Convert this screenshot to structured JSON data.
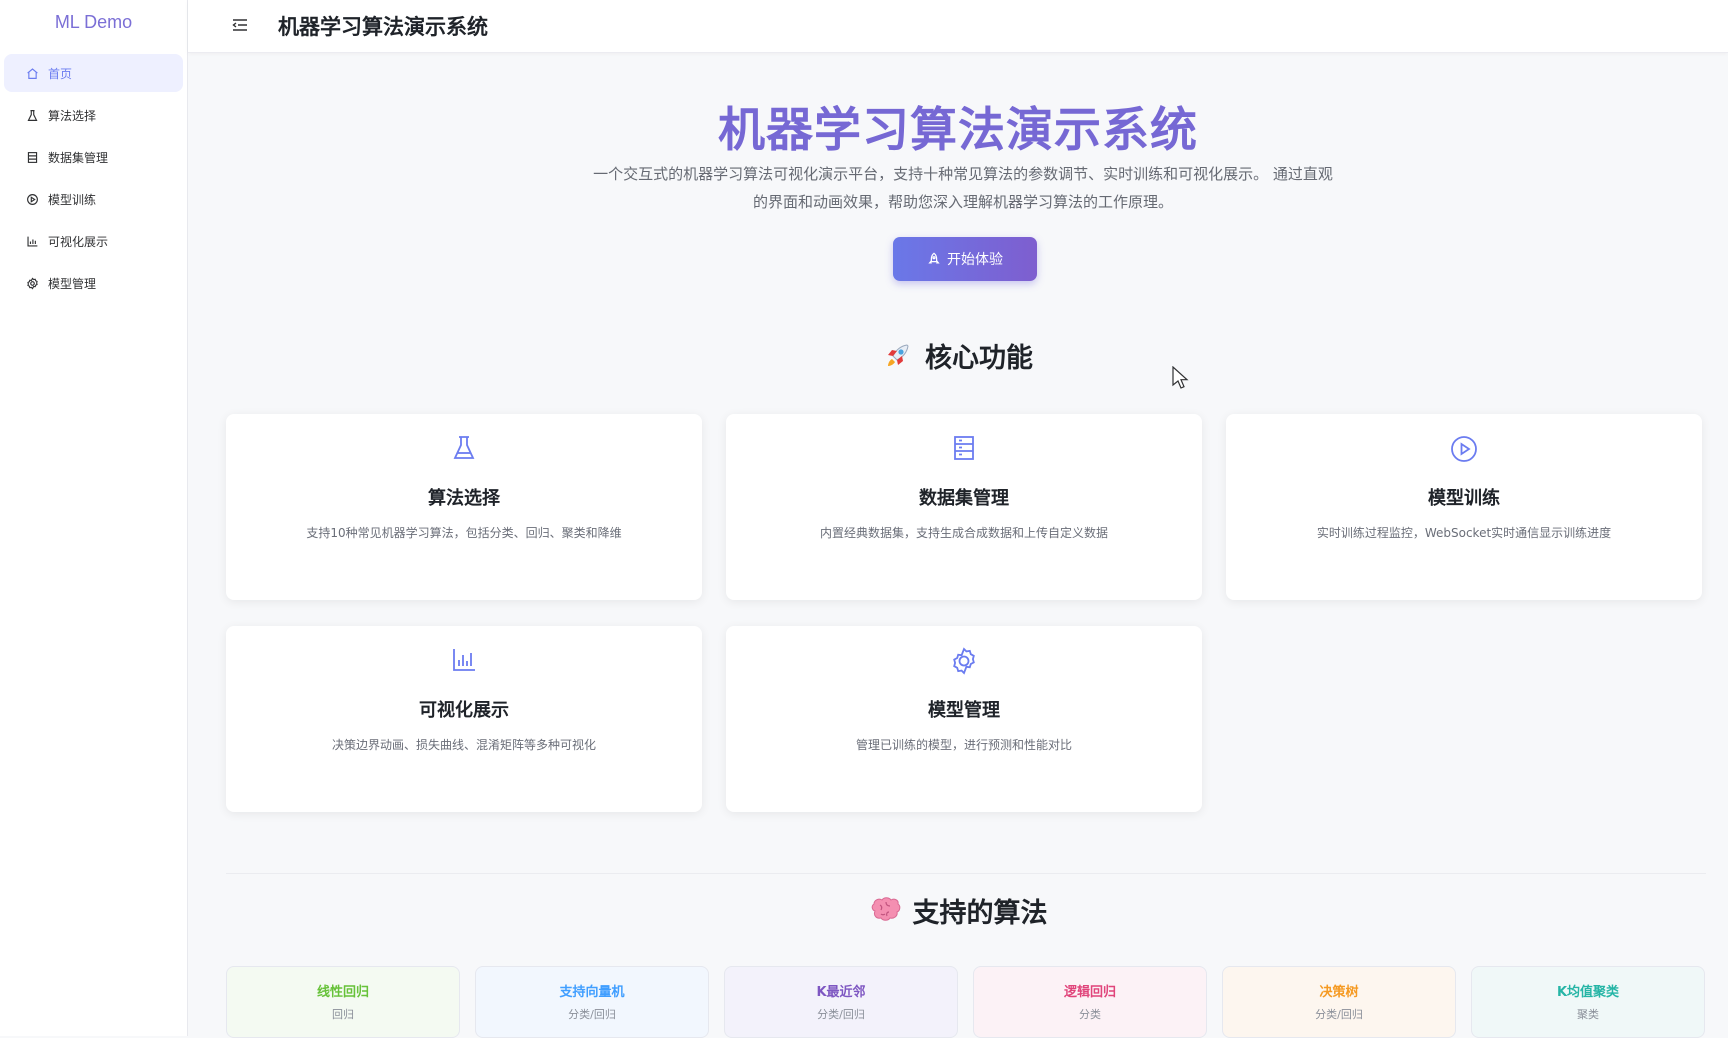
{
  "sidebar": {
    "logo": "ML Demo",
    "items": [
      {
        "label": "首页",
        "icon": "home-icon",
        "active": true
      },
      {
        "label": "算法选择",
        "icon": "flask-icon",
        "active": false
      },
      {
        "label": "数据集管理",
        "icon": "database-icon",
        "active": false
      },
      {
        "label": "模型训练",
        "icon": "play-circle-icon",
        "active": false
      },
      {
        "label": "可视化展示",
        "icon": "chart-icon",
        "active": false
      },
      {
        "label": "模型管理",
        "icon": "gear-icon",
        "active": false
      }
    ]
  },
  "header": {
    "title": "机器学习算法演示系统"
  },
  "hero": {
    "title": "机器学习算法演示系统",
    "description": "一个交互式的机器学习算法可视化演示平台，支持十种常见算法的参数调节、实时训练和可视化展示。 通过直观的界面和动画效果，帮助您深入理解机器学习算法的工作原理。",
    "button": "开始体验"
  },
  "features": {
    "title": "核心功能",
    "cards": [
      {
        "title": "算法选择",
        "desc": "支持10种常见机器学习算法，包括分类、回归、聚类和降维",
        "icon": "flask-icon"
      },
      {
        "title": "数据集管理",
        "desc": "内置经典数据集，支持生成合成数据和上传自定义数据",
        "icon": "database-icon"
      },
      {
        "title": "模型训练",
        "desc": "实时训练过程监控，WebSocket实时通信显示训练进度",
        "icon": "play-circle-icon"
      },
      {
        "title": "可视化展示",
        "desc": "决策边界动画、损失曲线、混淆矩阵等多种可视化",
        "icon": "chart-icon"
      },
      {
        "title": "模型管理",
        "desc": "管理已训练的模型，进行预测和性能对比",
        "icon": "gear-icon"
      }
    ]
  },
  "algorithms": {
    "title": "支持的算法",
    "items": [
      {
        "name": "线性回归",
        "type": "回归",
        "color": "#67c23a",
        "bg": "#f4faf2"
      },
      {
        "name": "支持向量机",
        "type": "分类/回归",
        "color": "#409eff",
        "bg": "#f2f7fe"
      },
      {
        "name": "K最近邻",
        "type": "分类/回归",
        "color": "#7e57c2",
        "bg": "#f3f2fb"
      },
      {
        "name": "逻辑回归",
        "type": "分类",
        "color": "#e0457b",
        "bg": "#fcf2f6"
      },
      {
        "name": "决策树",
        "type": "分类/回归",
        "color": "#f59a23",
        "bg": "#fdf6ef"
      },
      {
        "name": "K均值聚类",
        "type": "聚类",
        "color": "#26b5a6",
        "bg": "#f0f8f8"
      }
    ]
  },
  "colors": {
    "accent": "#6b7cf0",
    "hero_title": "#7668d4"
  }
}
